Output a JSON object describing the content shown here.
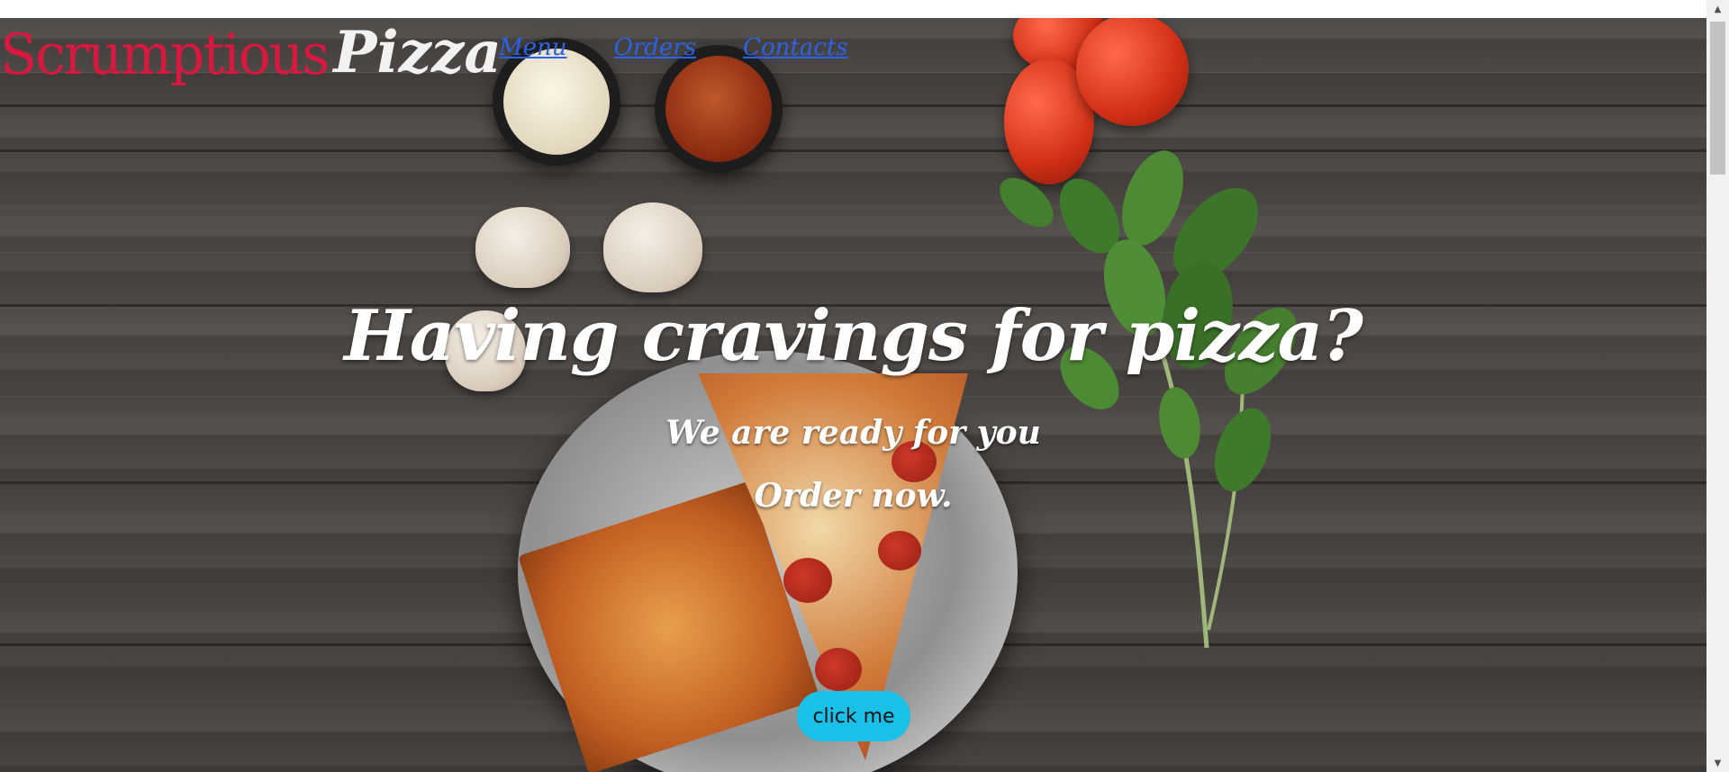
{
  "brand": {
    "word1": "Scrumptious",
    "word2": "Pizza",
    "word1_color": "#d7193f",
    "word2_color": "#f2f2f2"
  },
  "nav": {
    "items": [
      {
        "label": "Menu"
      },
      {
        "label": "Orders"
      },
      {
        "label": "Contacts"
      }
    ],
    "link_color": "#2b63e8"
  },
  "hero": {
    "headline": "Having cravings for pizza?",
    "subline1": "We are ready for you",
    "subline2": "Order now.",
    "cta_label": "click me",
    "cta_color": "#19c0e8"
  },
  "scrollbar": {
    "up_icon": "scroll-up-arrow",
    "down_icon": "scroll-down-arrow"
  }
}
